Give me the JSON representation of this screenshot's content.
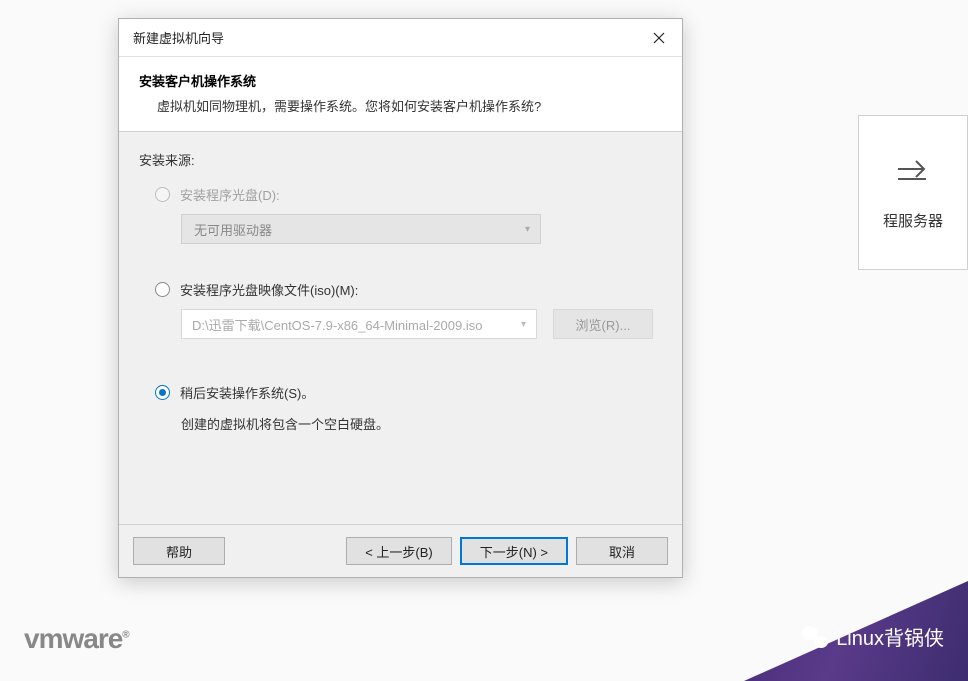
{
  "background": {
    "tile_label": "程服务器"
  },
  "dialog": {
    "title": "新建虚拟机向导",
    "header_title": "安装客户机操作系统",
    "header_desc": "虚拟机如同物理机，需要操作系统。您将如何安装客户机操作系统?",
    "group_label": "安装来源:",
    "option_disc": {
      "label": "安装程序光盘(D):",
      "combo_text": "无可用驱动器"
    },
    "option_iso": {
      "label": "安装程序光盘映像文件(iso)(M):",
      "path": "D:\\迅雷下载\\CentOS-7.9-x86_64-Minimal-2009.iso",
      "browse": "浏览(R)..."
    },
    "option_later": {
      "label": "稍后安装操作系统(S)。",
      "hint": "创建的虚拟机将包含一个空白硬盘。"
    },
    "buttons": {
      "help": "帮助",
      "back": "< 上一步(B)",
      "next": "下一步(N) >",
      "cancel": "取消"
    }
  },
  "branding": {
    "vmware": "vmware",
    "reg": "®",
    "channel": "Linux背锅侠"
  }
}
